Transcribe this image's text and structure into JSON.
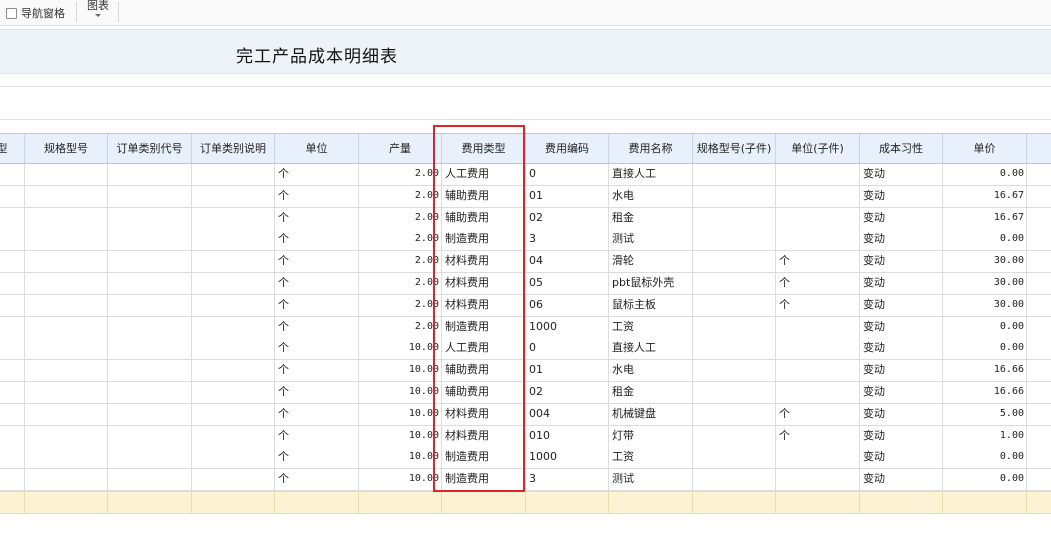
{
  "toolbar": {
    "nav_pane_label": "导航窗格",
    "nav_pane_checked": false,
    "chart_label": "图表",
    "chart_icon": "caret-down-icon"
  },
  "report": {
    "title": "完工产品成本明细表"
  },
  "table": {
    "columns": [
      "型",
      "规格型号",
      "订单类别代号",
      "订单类别说明",
      "单位",
      "产量",
      "费用类型",
      "费用编码",
      "费用名称",
      "规格型号(子件)",
      "单位(子件)",
      "成本习性",
      "单价"
    ],
    "rows": [
      [
        "",
        "",
        "",
        "",
        "个",
        "2.00",
        "人工费用",
        "0",
        "直接人工",
        "",
        "",
        "变动",
        "0.00"
      ],
      [
        "",
        "",
        "",
        "",
        "个",
        "2.00",
        "辅助费用",
        "01",
        "水电",
        "",
        "",
        "变动",
        "16.67"
      ],
      [
        "",
        "",
        "",
        "",
        "个",
        "2.00",
        "辅助费用",
        "02",
        "租金",
        "",
        "",
        "变动",
        "16.67"
      ],
      [
        "",
        "",
        "",
        "",
        "个",
        "2.00",
        "制造费用",
        "3",
        "测试",
        "",
        "",
        "变动",
        "0.00"
      ],
      [
        "",
        "",
        "",
        "",
        "个",
        "2.00",
        "材料费用",
        "04",
        "滑轮",
        "",
        "个",
        "变动",
        "30.00"
      ],
      [
        "",
        "",
        "",
        "",
        "个",
        "2.00",
        "材料费用",
        "05",
        "pbt鼠标外壳",
        "",
        "个",
        "变动",
        "30.00"
      ],
      [
        "",
        "",
        "",
        "",
        "个",
        "2.00",
        "材料费用",
        "06",
        "鼠标主板",
        "",
        "个",
        "变动",
        "30.00"
      ],
      [
        "",
        "",
        "",
        "",
        "个",
        "2.00",
        "制造费用",
        "1000",
        "工资",
        "",
        "",
        "变动",
        "0.00"
      ],
      [
        "",
        "",
        "",
        "",
        "个",
        "10.00",
        "人工费用",
        "0",
        "直接人工",
        "",
        "",
        "变动",
        "0.00"
      ],
      [
        "",
        "",
        "",
        "",
        "个",
        "10.00",
        "辅助费用",
        "01",
        "水电",
        "",
        "",
        "变动",
        "16.66"
      ],
      [
        "",
        "",
        "",
        "",
        "个",
        "10.00",
        "辅助费用",
        "02",
        "租金",
        "",
        "",
        "变动",
        "16.66"
      ],
      [
        "",
        "",
        "",
        "",
        "个",
        "10.00",
        "材料费用",
        "004",
        "机械键盘",
        "",
        "个",
        "变动",
        "5.00"
      ],
      [
        "",
        "",
        "",
        "",
        "个",
        "10.00",
        "材料费用",
        "010",
        "灯带",
        "",
        "个",
        "变动",
        "1.00"
      ],
      [
        "",
        "",
        "",
        "",
        "个",
        "10.00",
        "制造费用",
        "1000",
        "工资",
        "",
        "",
        "变动",
        "0.00"
      ],
      [
        "",
        "",
        "",
        "",
        "个",
        "10.00",
        "制造费用",
        "3",
        "测试",
        "",
        "",
        "变动",
        "0.00"
      ]
    ]
  },
  "annotation": {
    "highlight_color": "#e0232a"
  }
}
